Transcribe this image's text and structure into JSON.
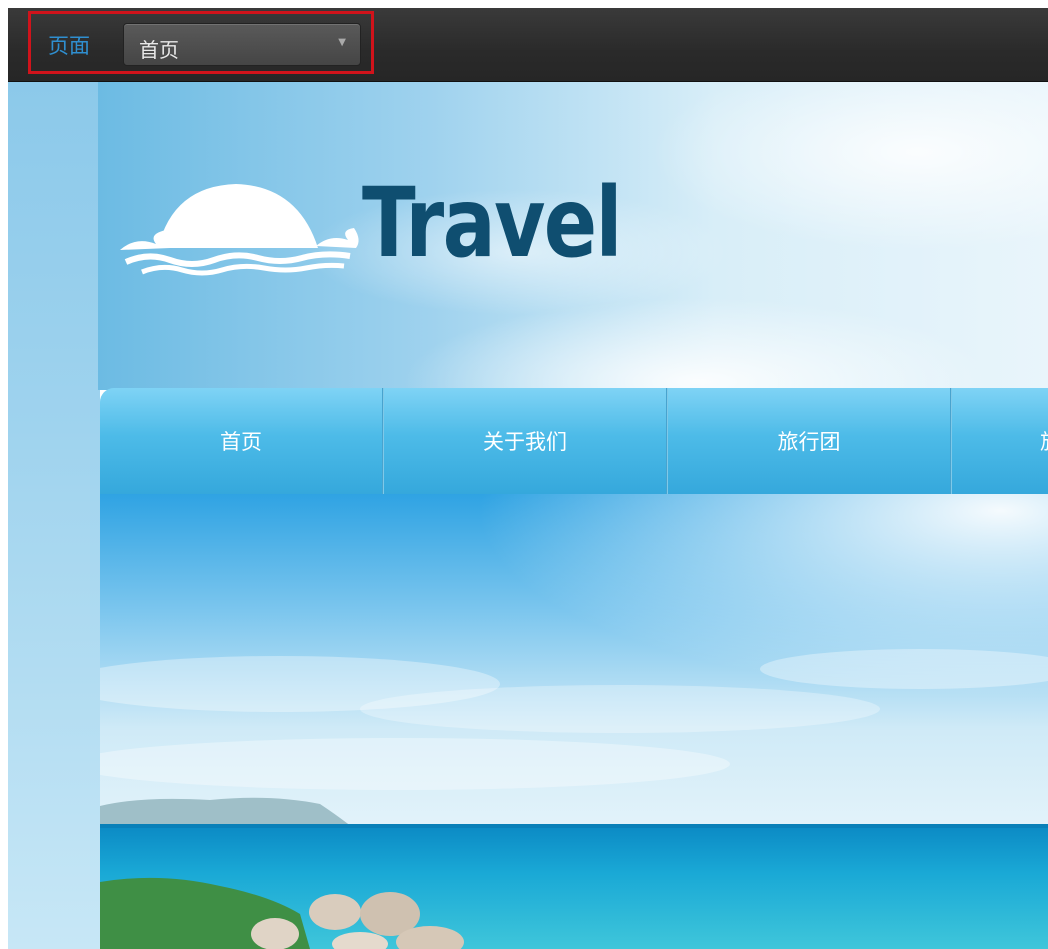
{
  "editor": {
    "page_label": "页面",
    "page_select_value": "首页"
  },
  "site": {
    "brand": "Travel"
  },
  "nav": {
    "items": [
      {
        "label": "首页"
      },
      {
        "label": "关于我们"
      },
      {
        "label": "旅行团"
      },
      {
        "label": "旅"
      }
    ]
  },
  "colors": {
    "highlight": "#d0131b",
    "brand_text": "#0f4e70",
    "nav_blue": "#4dbbe8",
    "page_label": "#2f8fd0"
  }
}
